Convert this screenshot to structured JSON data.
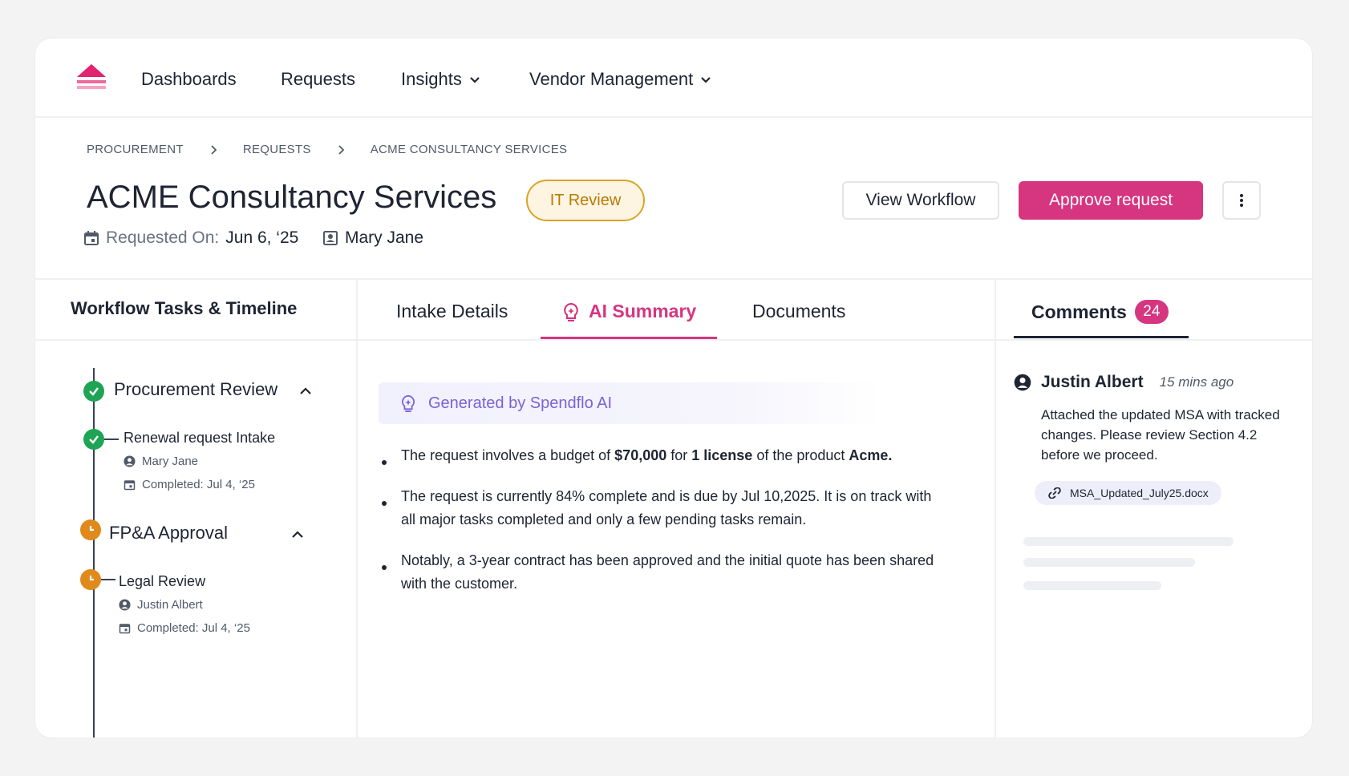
{
  "nav": {
    "items": [
      {
        "label": "Dashboards"
      },
      {
        "label": "Requests"
      },
      {
        "label": "Insights"
      },
      {
        "label": "Vendor Management"
      }
    ]
  },
  "breadcrumb": [
    "PROCUREMENT",
    "REQUESTS",
    "ACME CONSULTANCY SERVICES"
  ],
  "header": {
    "title": "ACME Consultancy Services",
    "status_badge": "IT Review",
    "view_workflow_label": "View Workflow",
    "approve_label": "Approve request",
    "requested_on_label": "Requested On:",
    "requested_on_value": "Jun 6, ‘25",
    "requester": "Mary Jane"
  },
  "workflow": {
    "title": "Workflow Tasks & Timeline",
    "stages": [
      {
        "name": "Procurement Review",
        "status": "completed",
        "tasks": [
          {
            "name": "Renewal request Intake",
            "assignee": "Mary Jane",
            "completed": "Completed: Jul 4, ‘25"
          }
        ]
      },
      {
        "name": "FP&A Approval",
        "status": "pending",
        "tasks": [
          {
            "name": "Legal Review",
            "assignee": "Justin Albert",
            "completed": "Completed: Jul 4, ‘25"
          }
        ]
      }
    ]
  },
  "tabs": [
    {
      "label": "Intake Details"
    },
    {
      "label": "AI Summary"
    },
    {
      "label": "Documents"
    }
  ],
  "ai_summary": {
    "banner": "Generated by Spendflo AI",
    "bullets": [
      {
        "p1": "The request involves a budget of ",
        "b1": "$70,000",
        "p2": " for ",
        "b2": "1 license",
        "p3": " of the product ",
        "b3": "Acme."
      },
      {
        "text": "The request is currently 84% complete and is due by Jul 10,2025. It is on track with all major tasks completed and only a few pending tasks remain."
      },
      {
        "text": "Notably, a 3-year contract has been approved and the initial quote has been shared with the customer."
      }
    ]
  },
  "comments": {
    "tab_label": "Comments",
    "count": "24",
    "items": [
      {
        "author": "Justin Albert",
        "time": "15 mins ago",
        "text": "Attached the updated MSA with tracked changes. Please review Section 4.2 before we proceed.",
        "attachment": "MSA_Updated_July25.docx"
      }
    ]
  },
  "colors": {
    "brand": "#d6357f",
    "success": "#1ea454",
    "warning": "#e08a1b",
    "ai_accent": "#7a63d6"
  }
}
